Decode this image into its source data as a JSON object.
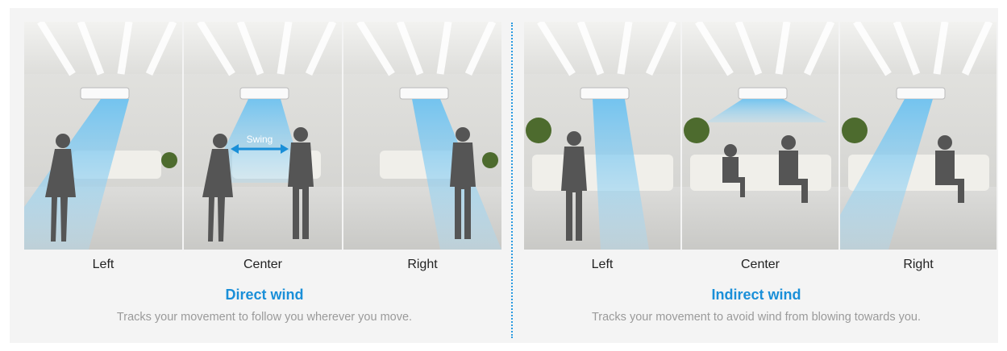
{
  "direct": {
    "labels": [
      "Left",
      "Center",
      "Right"
    ],
    "swing_label": "Swing",
    "title": "Direct wind",
    "description": "Tracks your movement to follow you wherever you move."
  },
  "indirect": {
    "labels": [
      "Left",
      "Center",
      "Right"
    ],
    "title": "Indirect wind",
    "description": "Tracks your movement to avoid wind from blowing towards you."
  },
  "colors": {
    "accent": "#1a8fd8",
    "divider": "#2a9ae0",
    "airflow": "#7fc8f0",
    "silhouette": "#555555"
  }
}
